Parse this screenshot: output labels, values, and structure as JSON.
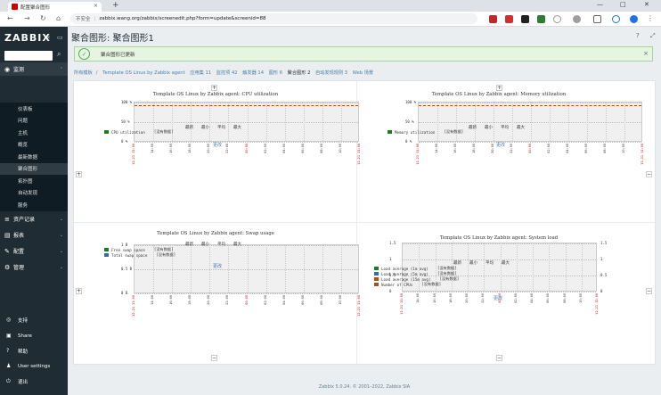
{
  "browser": {
    "tab_title": "配置聚合图形",
    "url_security": "不安全",
    "url": "zabbix.wang.org/zabbix/screenedit.php?form=update&screenid=88"
  },
  "sidebar": {
    "logo": "ZABBIX",
    "sections": [
      {
        "label": "监测",
        "icon": "eye-icon",
        "active": true
      },
      {
        "label": "资产记录",
        "icon": "list-icon"
      },
      {
        "label": "报表",
        "icon": "chart-icon"
      },
      {
        "label": "配置",
        "icon": "wrench-icon"
      },
      {
        "label": "管理",
        "icon": "gear-icon"
      }
    ],
    "monitoring_items": [
      "仪表板",
      "问题",
      "主机",
      "概览",
      "最新数据",
      "聚合图形",
      "拓扑图",
      "自动发现",
      "服务"
    ],
    "active_item": "聚合图形",
    "bottom": [
      {
        "label": "支持",
        "icon": "support-icon"
      },
      {
        "label": "Share",
        "icon": "share-icon"
      },
      {
        "label": "帮助",
        "icon": "help-icon"
      },
      {
        "label": "User settings",
        "icon": "user-icon"
      },
      {
        "label": "退出",
        "icon": "power-icon"
      }
    ]
  },
  "page": {
    "title": "聚合图形: 聚合图形1",
    "message": "聚合图形已更新",
    "footer": "Zabbix 5.0.24. © 2001–2022, Zabbix SIA"
  },
  "breadcrumbs": [
    "所有模板",
    "Template OS Linux by Zabbix agent",
    "应用集 11",
    "监控项 42",
    "触发器 14",
    "图形 6",
    "聚合图形 2",
    "自动发现规则 3",
    "Web 场景"
  ],
  "graphs": [
    {
      "title": "Template OS Linux by Zabbix agent: CPU utilization",
      "yticks": [
        "100 %",
        "50 %",
        "0 %"
      ],
      "legend": [
        {
          "color": "#1a7f1a",
          "name": "CPU utilization",
          "value": "[没有数据]"
        }
      ],
      "stats": [
        "最新",
        "最小",
        "平均",
        "最大"
      ],
      "change": "更改"
    },
    {
      "title": "Template OS Linux by Zabbix agent: Memory utilization",
      "yticks": [
        "100 %",
        "50 %",
        "0 %"
      ],
      "legend": [
        {
          "color": "#1a7f1a",
          "name": "Memory utilization",
          "value": "[没有数据]"
        }
      ],
      "stats": [
        "最新",
        "最小",
        "平均",
        "最大"
      ],
      "change": "更改"
    },
    {
      "title": "Template OS Linux by Zabbix agent: Swap usage",
      "yticks": [
        "1 B",
        "0.5 B",
        "0 B"
      ],
      "legend": [
        {
          "color": "#1a7f1a",
          "name": "Free swap space",
          "value": "[没有数据]"
        },
        {
          "color": "#2774a4",
          "name": "Total swap space",
          "value": "[没有数据]"
        }
      ],
      "stats": [
        "最新",
        "最小",
        "平均",
        "最大"
      ],
      "change": "更改"
    },
    {
      "title": "Template OS Linux by Zabbix agent: System load",
      "yticks": [
        "1.5",
        "1",
        "0.5",
        "0"
      ],
      "legend": [
        {
          "color": "#1a7f1a",
          "name": "Load average (1m avg)",
          "value": "[没有数据]"
        },
        {
          "color": "#2774a4",
          "name": "Load average (5m avg)",
          "value": "[没有数据]"
        },
        {
          "color": "#c8420d",
          "name": "Load average (15m avg)",
          "value": "[没有数据]"
        },
        {
          "color": "#8c5a2b",
          "name": "Number of CPUs",
          "value": "[没有数据]"
        }
      ],
      "stats": [
        "最新",
        "最小",
        "平均",
        "最大"
      ],
      "change": "更改"
    }
  ],
  "controls": {
    "plus": "+",
    "minus": "−"
  },
  "colors": {
    "sidebar": "#1f2c33",
    "accent": "#4c7ea9",
    "trigger": "#c8420d",
    "success": "#59a45b"
  }
}
